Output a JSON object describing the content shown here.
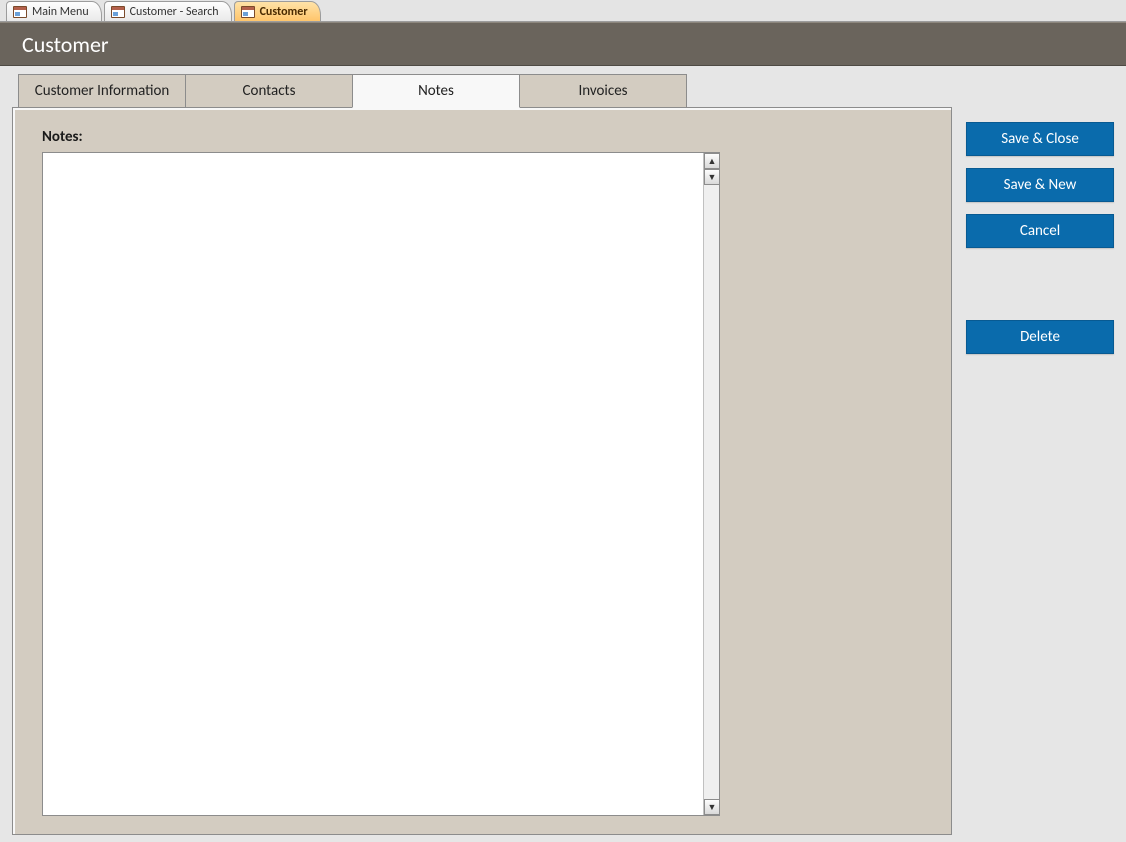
{
  "window_tabs": [
    {
      "label": "Main Menu",
      "active": false
    },
    {
      "label": "Customer - Search",
      "active": false
    },
    {
      "label": "Customer",
      "active": true
    }
  ],
  "header": {
    "title": "Customer"
  },
  "tabs": [
    {
      "label": "Customer Information"
    },
    {
      "label": "Contacts"
    },
    {
      "label": "Notes"
    },
    {
      "label": "Invoices"
    }
  ],
  "active_tab_index": 2,
  "notes": {
    "label": "Notes:",
    "value": ""
  },
  "buttons": {
    "save_close": "Save & Close",
    "save_new": "Save & New",
    "cancel": "Cancel",
    "delete": "Delete"
  },
  "scroll": {
    "up_glyph": "▲",
    "down_glyph": "▼"
  }
}
